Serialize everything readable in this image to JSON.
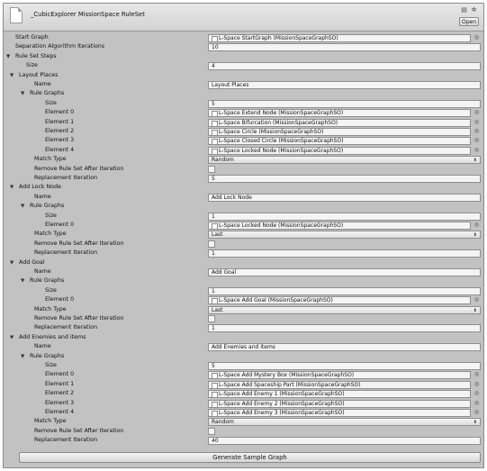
{
  "window": {
    "title": "_CubicExplorer MissionSpace RuleSet",
    "open_button": "Open",
    "help_icon": "help-book-icon",
    "settings_icon": "settings-gear-icon"
  },
  "fields": {
    "start_graph": {
      "label": "Start Graph",
      "value": "L-Space StartGraph (MissionSpaceGraphSO)"
    },
    "separation_iterations": {
      "label": "Separation Algorithm Iterations",
      "value": "10"
    }
  },
  "rule_set_steps": {
    "label": "Rule Set Steps",
    "size_label": "Size",
    "size_value": "4",
    "common": {
      "name_label": "Name",
      "rule_graphs_label": "Rule Graphs",
      "size_label": "Size",
      "match_type_label": "Match Type",
      "remove_label": "Remove Rule Set After Iteration",
      "replacement_label": "Replacement Iteration",
      "element_labels": [
        "Element 0",
        "Element 1",
        "Element 2",
        "Element 3",
        "Element 4"
      ]
    },
    "steps": [
      {
        "title": "Layout Places",
        "name_value": "Layout Places",
        "rule_graphs_size": "5",
        "elements": [
          "L-Space Extend Node (MissionSpaceGraphSO)",
          "L-Space Bifurcation (MissionSpaceGraphSO)",
          "L-Space Circle (MissionSpaceGraphSO)",
          "L-Space Closed Circle (MissionSpaceGraphSO)",
          "L-Space Locked Node (MissionSpaceGraphSO)"
        ],
        "match_type": "Random",
        "replacement_iteration": "5"
      },
      {
        "title": "Add Lock Node",
        "name_value": "Add Lock Node",
        "rule_graphs_size": "1",
        "elements": [
          "L-Space Locked Node (MissionSpaceGraphSO)"
        ],
        "match_type": "Last",
        "replacement_iteration": "1"
      },
      {
        "title": "Add Goal",
        "name_value": "Add Goal",
        "rule_graphs_size": "1",
        "elements": [
          "L-Space Add Goal (MissionSpaceGraphSO)"
        ],
        "match_type": "Last",
        "replacement_iteration": "1"
      },
      {
        "title": "Add Enemies and items",
        "name_value": "Add Enemies and items",
        "rule_graphs_size": "5",
        "elements": [
          "L-Space Add Mystery Box (MissionSpaceGraphSO)",
          "L-Space Add Spaceship Part (MissionSpaceGraphSO)",
          "L-Space Add Enemy 1 (MissionSpaceGraphSO)",
          "L-Space Add Enemy 2 (MissionSpaceGraphSO)",
          "L-Space Add Enemy 3 (MissionSpaceGraphSO)"
        ],
        "match_type": "Random",
        "replacement_iteration": "40"
      }
    ]
  },
  "generate_button": "Generate Sample Graph"
}
